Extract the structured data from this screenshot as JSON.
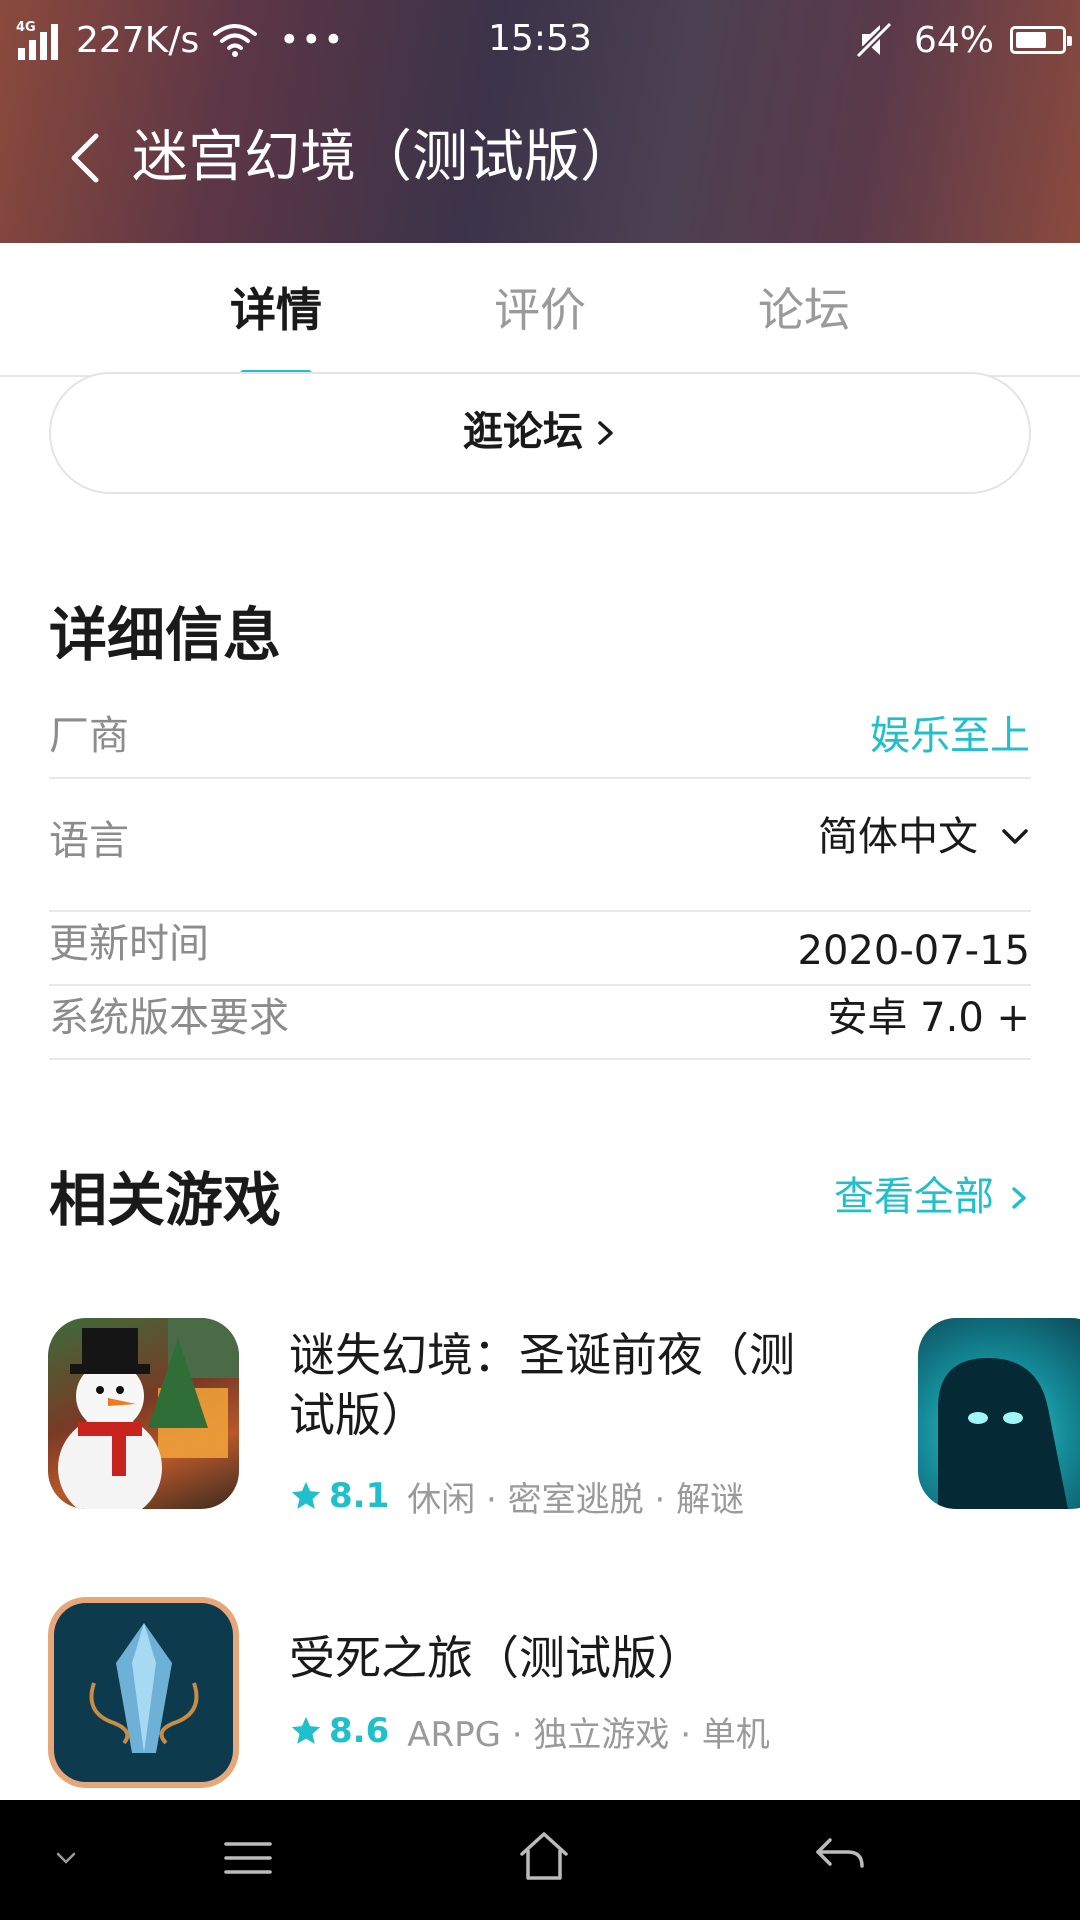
{
  "status_bar": {
    "network": "4G",
    "speed": "227K/s",
    "more": "•••",
    "time": "15:53",
    "battery": "64%",
    "battery_level": 0.64
  },
  "header": {
    "title": "迷宫幻境（测试版）"
  },
  "tabs": [
    {
      "label": "详情",
      "active": true
    },
    {
      "label": "评价",
      "active": false
    },
    {
      "label": "论坛",
      "active": false
    }
  ],
  "forum_button": {
    "label": "逛论坛"
  },
  "details": {
    "title": "详细信息",
    "rows": [
      {
        "label": "厂商",
        "value": "娱乐至上"
      },
      {
        "label": "语言",
        "value": "简体中文"
      },
      {
        "label": "更新时间",
        "value": "2020-07-15"
      },
      {
        "label": "系统版本要求",
        "value": "安卓 7.0 +"
      }
    ]
  },
  "related": {
    "title": "相关游戏",
    "see_all": "查看全部",
    "games": [
      {
        "name": "谜失幻境：圣诞前夜（测试版）",
        "score": "8.1",
        "tags": "休闲 · 密室逃脱 · 解谜"
      },
      {
        "name": "受死之旅（测试版）",
        "score": "8.6",
        "tags": "ARPG · 独立游戏 · 单机"
      }
    ]
  },
  "colors": {
    "accent": "#1fbfcb",
    "text_primary": "#1a1a1a",
    "text_secondary": "#8c8c8c"
  }
}
